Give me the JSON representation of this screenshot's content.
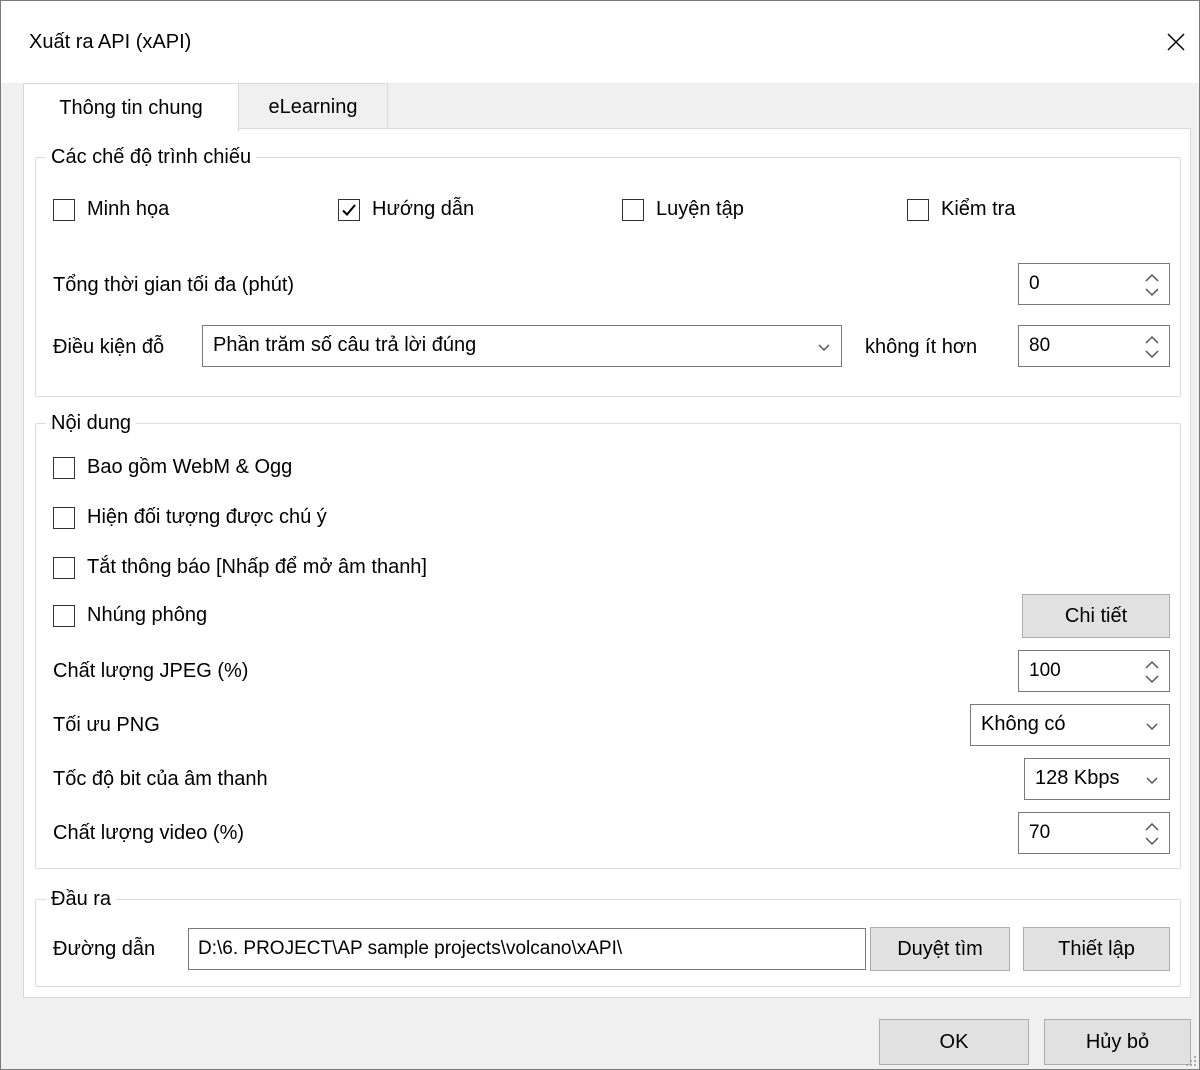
{
  "window": {
    "title": "Xuất ra  API (xAPI)"
  },
  "tabs": [
    {
      "label": "Thông tin chung",
      "active": true
    },
    {
      "label": "eLearning",
      "active": false
    }
  ],
  "modes": {
    "title": "Các chế độ trình chiếu",
    "checkboxes": [
      {
        "label": "Minh họa",
        "checked": false
      },
      {
        "label": "Hướng dẫn",
        "checked": true
      },
      {
        "label": "Luyện tập",
        "checked": false
      },
      {
        "label": "Kiểm tra",
        "checked": false
      }
    ],
    "max_time_label": "Tổng thời gian tối đa (phút)",
    "max_time_value": "0",
    "pass_label": "Điều kiện đỗ",
    "pass_condition": "Phần trăm số câu trả lời đúng",
    "not_less_label": "không ít hơn",
    "not_less_value": "80"
  },
  "content": {
    "title": "Nội dung",
    "checkboxes": [
      {
        "label": "Bao gồm WebM & Ogg",
        "checked": false
      },
      {
        "label": "Hiện đối tượng được chú ý",
        "checked": false
      },
      {
        "label": "Tắt thông báo [Nhấp để mở âm thanh]",
        "checked": false
      },
      {
        "label": "Nhúng phông",
        "checked": false
      }
    ],
    "details_button": "Chi tiết",
    "jpeg_label": "Chất lượng JPEG (%)",
    "jpeg_value": "100",
    "png_label": "Tối ưu PNG",
    "png_value": "Không có",
    "audio_label": "Tốc độ bit của âm thanh",
    "audio_value": "128 Kbps",
    "video_label": "Chất lượng video (%)",
    "video_value": "70"
  },
  "output": {
    "title": "Đầu ra",
    "path_label": "Đường dẫn",
    "path_value": "D:\\6. PROJECT\\AP sample projects\\volcano\\xAPI\\",
    "browse_button": "Duyệt tìm",
    "settings_button": "Thiết lập"
  },
  "footer": {
    "ok_button": "OK",
    "cancel_button": "Hủy bỏ"
  }
}
